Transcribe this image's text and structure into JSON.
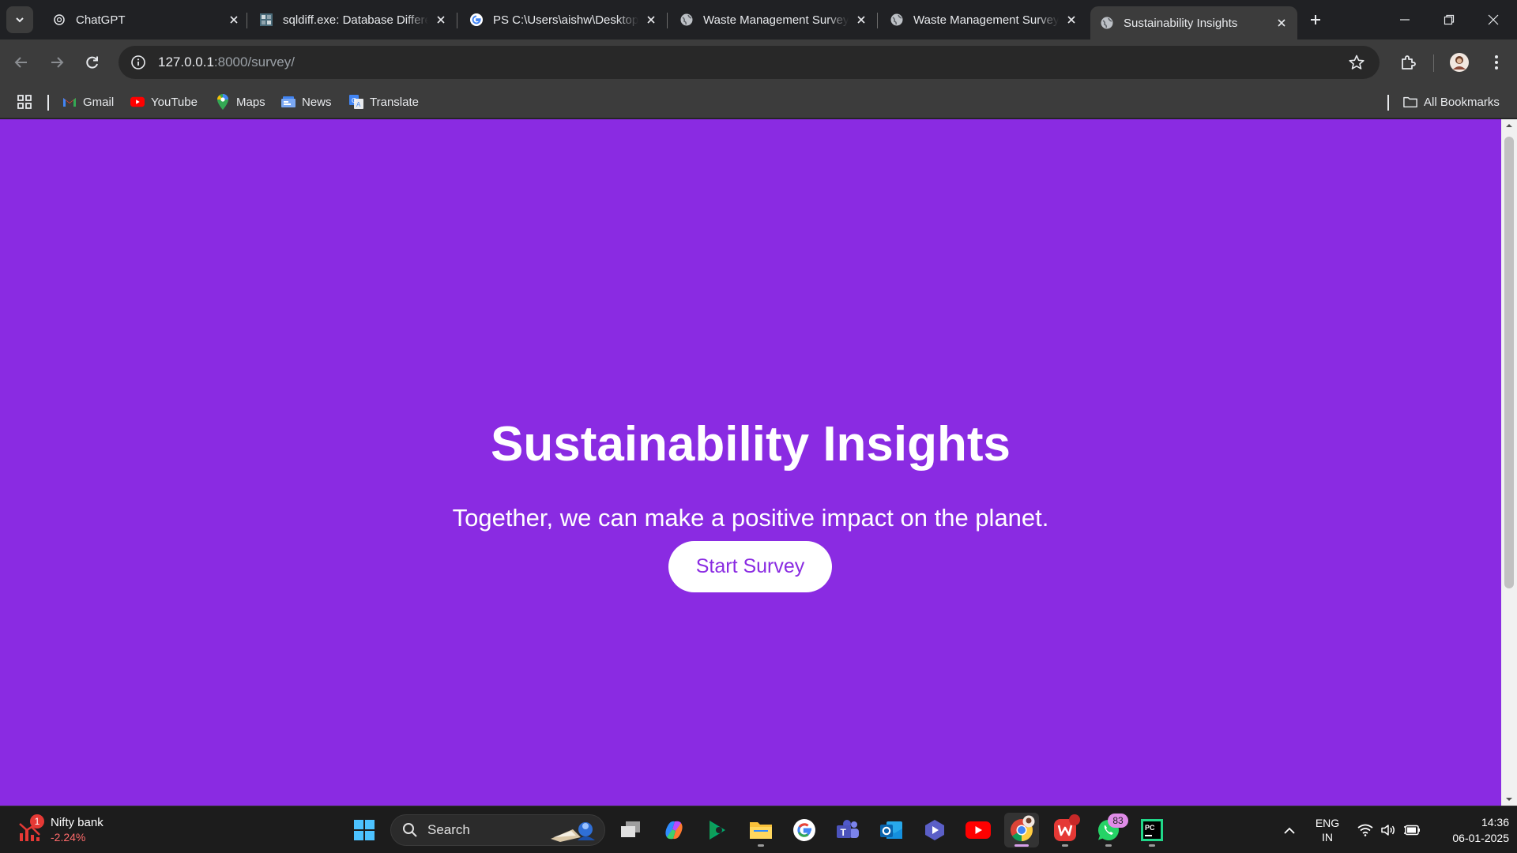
{
  "browser": {
    "tabs": [
      {
        "title": "ChatGPT",
        "icon": "chatgpt-icon"
      },
      {
        "title": "sqldiff.exe: Database Difference",
        "icon": "sqlite-icon"
      },
      {
        "title": "PS C:\\Users\\aishw\\Desktop",
        "icon": "google-icon"
      },
      {
        "title": "Waste Management Survey",
        "icon": "globe-icon"
      },
      {
        "title": "Waste Management Survey",
        "icon": "globe-icon"
      },
      {
        "title": "Sustainability Insights",
        "icon": "globe-icon",
        "active": true
      }
    ],
    "url_host": "127.0.0.1",
    "url_rest": ":8000/survey/"
  },
  "bookmarks": {
    "items": [
      {
        "label": "Gmail",
        "icon": "gmail-icon"
      },
      {
        "label": "YouTube",
        "icon": "youtube-icon"
      },
      {
        "label": "Maps",
        "icon": "maps-icon"
      },
      {
        "label": "News",
        "icon": "news-icon"
      },
      {
        "label": "Translate",
        "icon": "translate-icon"
      }
    ],
    "all_label": "All Bookmarks"
  },
  "page": {
    "title": "Sustainability Insights",
    "subtitle": "Together, we can make a positive impact on the planet.",
    "cta_label": "Start Survey",
    "background_color": "#8a2be2",
    "button_text_color": "#8a2be2"
  },
  "taskbar": {
    "widget_name": "Nifty bank",
    "widget_value": "-2.24%",
    "widget_badge": "1",
    "search_label": "Search",
    "whatsapp_badge": "83",
    "lang_line1": "ENG",
    "lang_line2": "IN",
    "time": "14:36",
    "date": "06-01-2025"
  }
}
